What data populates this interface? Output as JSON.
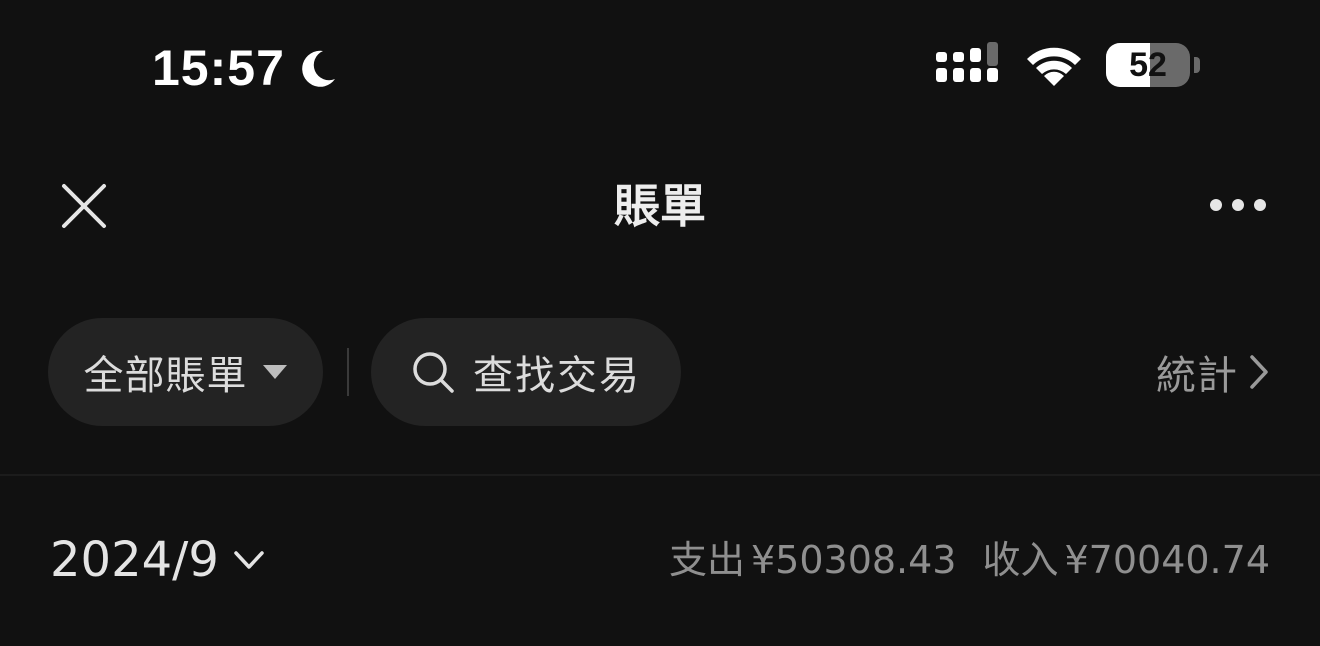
{
  "status_bar": {
    "time": "15:57",
    "focus_icon": "moon-icon",
    "signal_icon": "cellular-signal-icon",
    "wifi_icon": "wifi-icon",
    "battery_level": "52",
    "battery_fraction": 0.52
  },
  "nav": {
    "title": "賬單",
    "close_icon": "close-icon",
    "more_icon": "more-icon"
  },
  "filters": {
    "bill_type_label": "全部賬單",
    "search_label": "查找交易",
    "stats_label": "統計"
  },
  "month_summary": {
    "month": "2024/9",
    "expense_label": "支出",
    "expense_amount": "¥50308.43",
    "income_label": "收入",
    "income_amount": "¥70040.74"
  },
  "colors": {
    "background": "#111111",
    "chip_background": "#232323",
    "primary_text": "#e9e9e9",
    "secondary_text": "#8f8f8f"
  }
}
